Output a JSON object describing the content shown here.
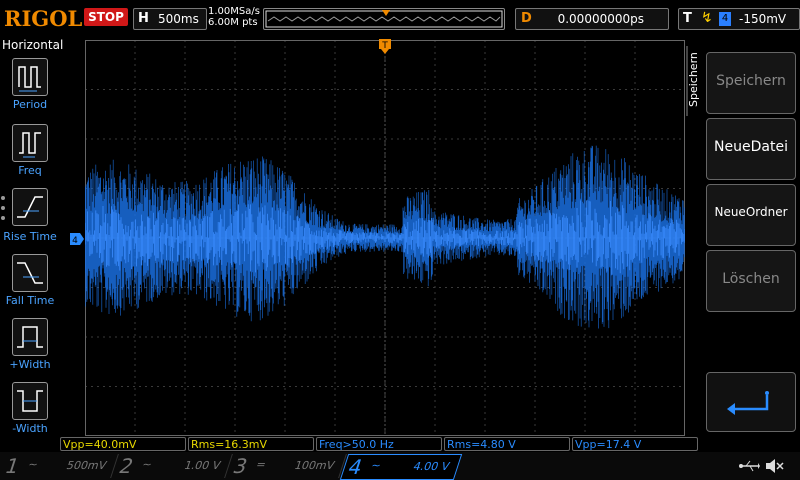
{
  "topbar": {
    "brand": "RIGOL",
    "run_state": "STOP",
    "horizontal_label": "H",
    "timebase": "500ms",
    "sample_rate": "1.00MSa/s",
    "memory_depth": "6.00M pts",
    "delay_label": "D",
    "delay_value": "0.00000000ps",
    "trigger_label": "T",
    "trigger_source": "4",
    "trigger_level": "-150mV"
  },
  "left_menu": {
    "title": "Horizontal",
    "items": [
      {
        "label": "Period",
        "icon": "period-icon"
      },
      {
        "label": "Freq",
        "icon": "freq-icon"
      },
      {
        "label": "Rise Time",
        "icon": "rise-time-icon"
      },
      {
        "label": "Fall Time",
        "icon": "fall-time-icon"
      },
      {
        "label": "+Width",
        "icon": "pos-width-icon"
      },
      {
        "label": "-Width",
        "icon": "neg-width-icon"
      }
    ]
  },
  "right_menu": {
    "tab": "Speichern",
    "items": [
      {
        "label": "Speichern",
        "enabled": false
      },
      {
        "label": "NeueDatei",
        "enabled": true
      },
      {
        "label": "NeueOrdner",
        "enabled": true
      },
      {
        "label": "Löschen",
        "enabled": false
      },
      {
        "label": "",
        "icon": "return-arrow-icon"
      }
    ]
  },
  "measurements": [
    {
      "text": "Vpp=40.0mV",
      "color": "#e8d800"
    },
    {
      "text": "Rms=16.3mV",
      "color": "#e8d800"
    },
    {
      "text": "Freq>50.0 Hz",
      "color": "#2a8cff"
    },
    {
      "text": "Rms=4.80 V",
      "color": "#2a8cff"
    },
    {
      "text": "Vpp=17.4 V",
      "color": "#2a8cff"
    }
  ],
  "channels": [
    {
      "num": "1",
      "coupling": "~",
      "scale": "500mV",
      "color": "#777777",
      "active": false
    },
    {
      "num": "2",
      "coupling": "~",
      "scale": "1.00 V",
      "color": "#777777",
      "active": false
    },
    {
      "num": "3",
      "coupling": "=",
      "scale": "100mV",
      "color": "#777777",
      "active": false
    },
    {
      "num": "4",
      "coupling": "~",
      "scale": "4.00 V",
      "color": "#2a8cff",
      "active": true
    }
  ],
  "colors": {
    "waveform": "#1a6fe0",
    "trigger_marker": "#f08a00",
    "channel4": "#2a8cff"
  }
}
